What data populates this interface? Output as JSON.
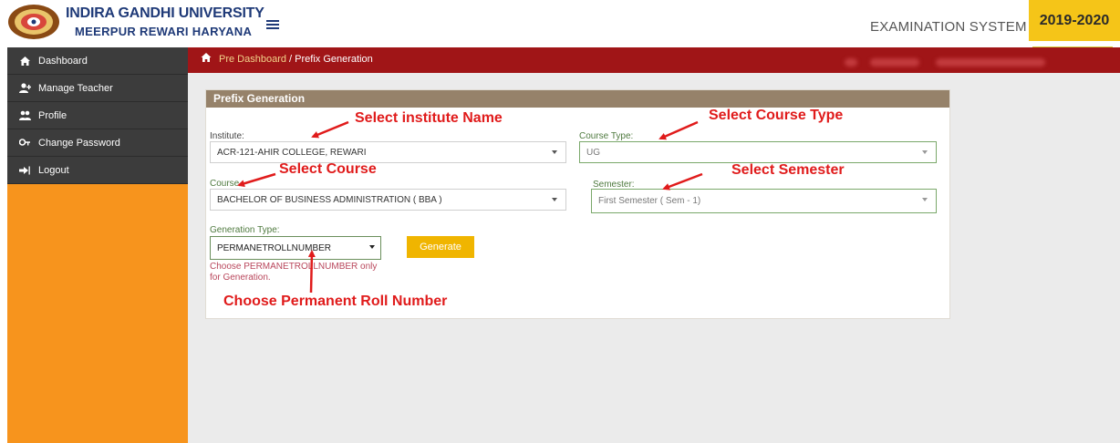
{
  "header": {
    "university_name": "INDIRA GANDHI UNIVERSITY",
    "university_location": "MEERPUR REWARI HARYANA",
    "system_name": "EXAMINATION SYSTEM",
    "session_year": "2019-2020"
  },
  "sidebar": {
    "items": [
      {
        "label": "Dashboard",
        "icon": "home-icon"
      },
      {
        "label": "Manage Teacher",
        "icon": "add-user-icon"
      },
      {
        "label": "Profile",
        "icon": "users-icon"
      },
      {
        "label": "Change Password",
        "icon": "key-icon"
      },
      {
        "label": "Logout",
        "icon": "logout-icon"
      }
    ]
  },
  "breadcrumb": {
    "root": "Pre Dashboard",
    "separator": " / ",
    "current": "Prefix Generation"
  },
  "panel": {
    "title": "Prefix Generation",
    "institute": {
      "label": "Institute:",
      "value": "ACR-121-AHIR COLLEGE, REWARI"
    },
    "course_type": {
      "label": "Course Type:",
      "value": "UG"
    },
    "course": {
      "label": "Course",
      "value": "BACHELOR OF BUSINESS ADMINISTRATION ( BBA )"
    },
    "semester": {
      "label": "Semester:",
      "value": "First Semester ( Sem - 1)"
    },
    "generation_type": {
      "label": "Generation Type:",
      "value": "PERMANETROLLNUMBER"
    },
    "generate_label": "Generate",
    "helper_text": "Choose PERMANETROLLNUMBER only for Generation."
  },
  "annotations": {
    "institute": "Select institute Name",
    "course_type": "Select Course Type",
    "course": "Select Course",
    "semester": "Select Semester",
    "generation": "Choose Permanent Roll Number"
  },
  "colors": {
    "sidebar_bg": "#f7941d",
    "menu_bg": "#3c3c3c",
    "breadcrumb_bg": "#a01517",
    "panel_header": "#96826a",
    "generate_button": "#f0b500",
    "year_badge": "#f5c518",
    "annotation": "#e01b1b"
  }
}
